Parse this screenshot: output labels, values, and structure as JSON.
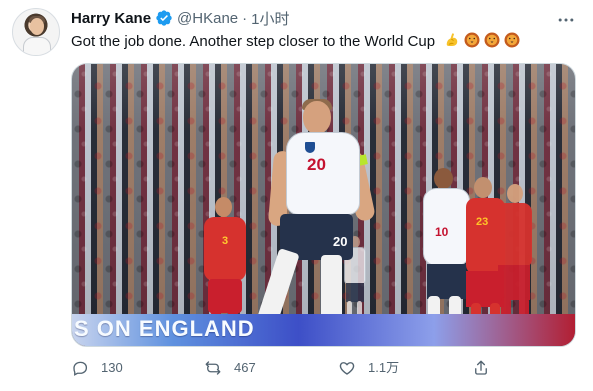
{
  "tweet": {
    "author": {
      "name": "Harry Kane",
      "handle": "@HKane",
      "verified_icon": "verified-badge-icon"
    },
    "separator": "·",
    "time": "1小时",
    "text": "Got the job done. Another step closer to the World Cup",
    "emojis": [
      "flexed-biceps-icon",
      "lion-face-icon",
      "lion-face-icon",
      "lion-face-icon"
    ],
    "more_icon": "more-horizontal-icon",
    "photo": {
      "board_text": "S ON ENGLAND",
      "shirt_numbers": {
        "kane": "20",
        "kane_shorts": "20",
        "left_player": "3",
        "center_player": "10",
        "red_player": "23"
      }
    },
    "actions": {
      "reply": {
        "icon": "reply-icon",
        "count": "130"
      },
      "retweet": {
        "icon": "retweet-icon",
        "count": "467"
      },
      "like": {
        "icon": "heart-icon",
        "count": "1.1万"
      },
      "share": {
        "icon": "share-icon"
      }
    },
    "colors": {
      "text": "#0f1419",
      "secondary": "#536471",
      "verified": "#1d9bf0",
      "border": "#cfd9de"
    }
  }
}
